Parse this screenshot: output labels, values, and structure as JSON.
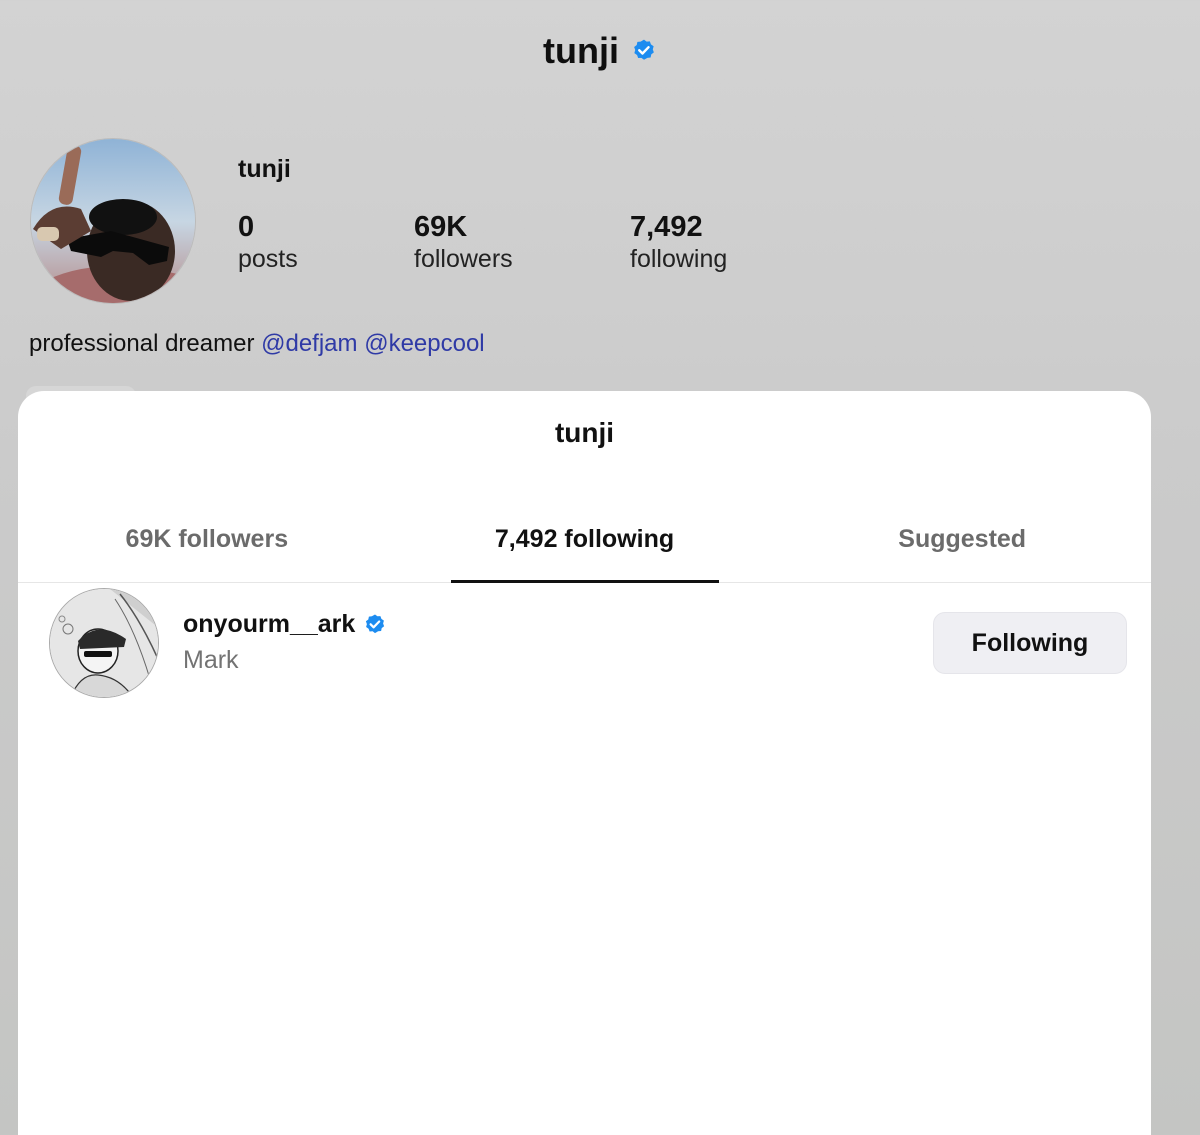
{
  "header": {
    "title": "tunji",
    "verified_icon": "verified-badge-icon",
    "verified_color": "#1d8cf0"
  },
  "profile": {
    "avatar_icon": "profile-photo",
    "username": "tunji",
    "stats": {
      "posts": {
        "value": "0",
        "label": "posts"
      },
      "followers": {
        "value": "69K",
        "label": "followers"
      },
      "following": {
        "value": "7,492",
        "label": "following"
      }
    },
    "bio": {
      "text": "professional dreamer",
      "mentions": [
        "@defjam",
        "@keepcool"
      ],
      "mention_color": "#2f3aa6"
    }
  },
  "modal": {
    "title": "tunji",
    "tabs": [
      {
        "label": "69K followers",
        "active": false
      },
      {
        "label": "7,492 following",
        "active": true
      },
      {
        "label": "Suggested",
        "active": false
      }
    ],
    "list": [
      {
        "handle": "onyourm__ark",
        "name": "Mark",
        "verified": true,
        "button_label": "Following"
      }
    ]
  }
}
